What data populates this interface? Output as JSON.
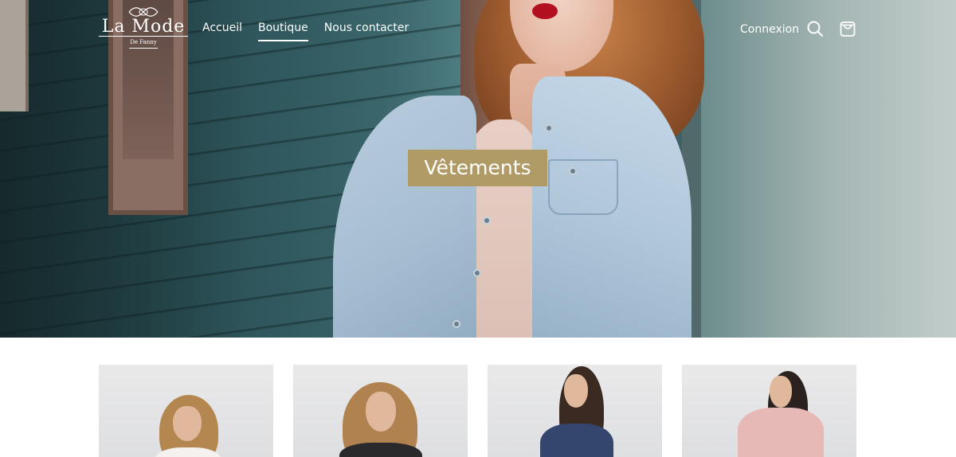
{
  "brand": {
    "name": "La Mode",
    "tagline": "De Fanny"
  },
  "nav": {
    "items": [
      {
        "label": "Accueil",
        "active": false
      },
      {
        "label": "Boutique",
        "active": true
      },
      {
        "label": "Nous contacter",
        "active": false
      }
    ]
  },
  "account": {
    "login_label": "Connexion",
    "search_icon": "search-icon",
    "cart_icon": "shopping-bag-icon"
  },
  "hero": {
    "title": "Vêtements",
    "label_color": "#b09a66"
  },
  "products": [
    {
      "name": "product-1"
    },
    {
      "name": "product-2"
    },
    {
      "name": "product-3"
    },
    {
      "name": "product-4"
    }
  ]
}
